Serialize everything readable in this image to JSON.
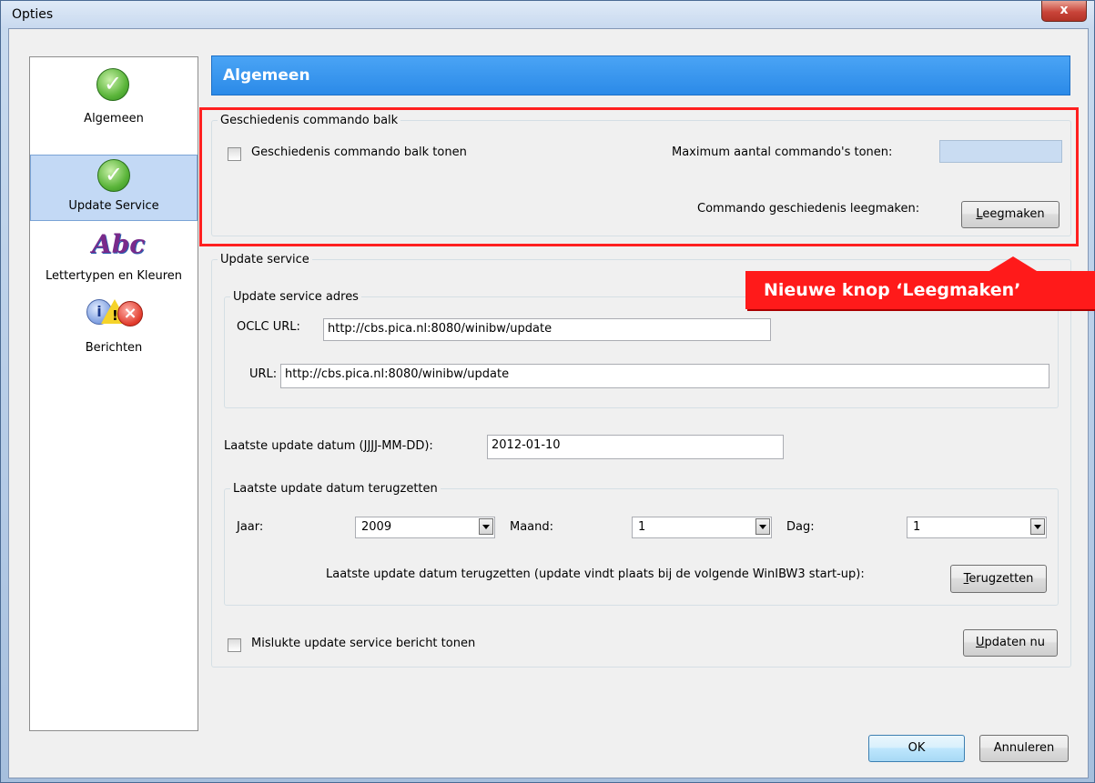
{
  "window": {
    "title": "Opties",
    "close_glyph": "x"
  },
  "sidebar": {
    "items": [
      {
        "label": "Algemeen",
        "icon": "check-icon"
      },
      {
        "label": "Update Service",
        "icon": "check-icon",
        "selected": true
      },
      {
        "label": "Lettertypen en Kleuren",
        "icon": "abc-icon"
      },
      {
        "label": "Berichten",
        "icon": "messages-icon"
      }
    ]
  },
  "header": {
    "title": "Algemeen"
  },
  "history": {
    "legend": "Geschiedenis commando balk",
    "show_label": "Geschiedenis commando balk tonen",
    "max_label": "Maximum aantal commando's tonen:",
    "max_value": "",
    "clear_label": "Commando geschiedenis leegmaken:",
    "clear_button": "Leegmaken",
    "clear_button_underlined": "L",
    "clear_button_rest": "eegmaken"
  },
  "callout": {
    "text": "Nieuwe knop ‘Leegmaken’"
  },
  "update": {
    "legend": "Update service",
    "address_legend": "Update service adres",
    "oclc_label": "OCLC URL:",
    "oclc_value": "http://cbs.pica.nl:8080/winibw/update",
    "url_label": "URL:",
    "url_value": "http://cbs.pica.nl:8080/winibw/update",
    "last_date_label": "Laatste update datum (JJJJ-MM-DD):",
    "last_date_value": "2012-01-10",
    "reset_legend": "Laatste update datum terugzetten",
    "year_label": "Jaar:",
    "year_value": "2009",
    "month_label": "Maand:",
    "month_value": "1",
    "day_label": "Dag:",
    "day_value": "1",
    "reset_text": "Laatste update datum terugzetten (update vindt plaats bij de volgende WinIBW3 start-up):",
    "reset_button_underlined": "T",
    "reset_button_rest": "erugzetten",
    "failed_label": "Mislukte update service bericht tonen",
    "update_now_underlined": "U",
    "update_now_rest": "pdaten nu"
  },
  "footer": {
    "ok": "OK",
    "cancel": "Annuleren"
  },
  "colors": {
    "header": "#2b8ae8",
    "highlight": "#ff1a1a",
    "selection": "#c3d9f5"
  }
}
